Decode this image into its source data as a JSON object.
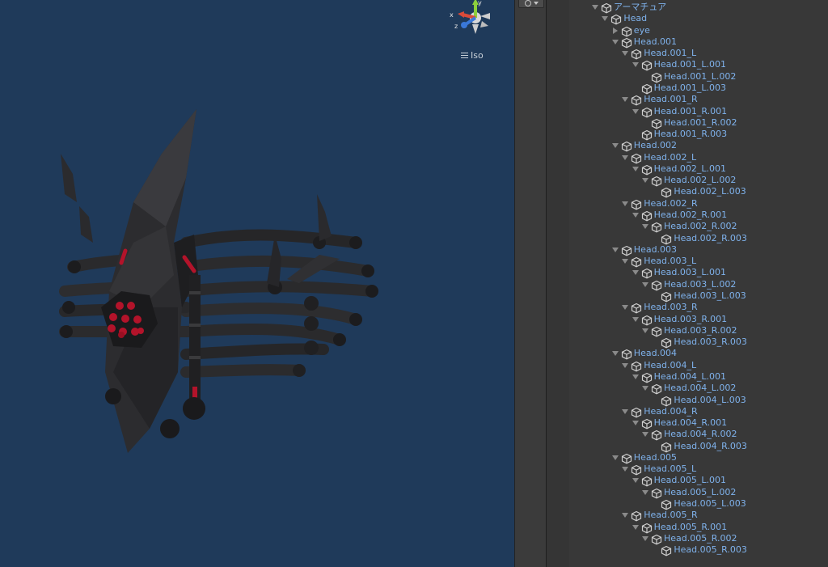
{
  "scene": {
    "view_mode_label": "Iso",
    "gizmo_axes": {
      "x": "x",
      "y": "y",
      "z": "z"
    },
    "colors": {
      "background": "#1f3a5a",
      "x_axis": "#d84a3a",
      "y_axis": "#8ccf3c",
      "z_axis": "#3a78d8",
      "accent_red": "#c0182a"
    },
    "icons": {
      "view_menu": "hamburger-icon"
    }
  },
  "toolbar": {
    "icons": [
      "gizmo-toggle-icon",
      "dropdown-arrow-icon"
    ]
  },
  "hierarchy": {
    "label_color": "#7fb2ec",
    "items": [
      {
        "label": "アーマチュア",
        "depth": 0,
        "expand": "down"
      },
      {
        "label": "Head",
        "depth": 1,
        "expand": "down"
      },
      {
        "label": "eye",
        "depth": 2,
        "expand": "right"
      },
      {
        "label": "Head.001",
        "depth": 2,
        "expand": "down"
      },
      {
        "label": "Head.001_L",
        "depth": 3,
        "expand": "down"
      },
      {
        "label": "Head.001_L.001",
        "depth": 4,
        "expand": "down"
      },
      {
        "label": "Head.001_L.002",
        "depth": 5,
        "expand": "none"
      },
      {
        "label": "Head.001_L.003",
        "depth": 4,
        "expand": "none"
      },
      {
        "label": "Head.001_R",
        "depth": 3,
        "expand": "down"
      },
      {
        "label": "Head.001_R.001",
        "depth": 4,
        "expand": "down"
      },
      {
        "label": "Head.001_R.002",
        "depth": 5,
        "expand": "none"
      },
      {
        "label": "Head.001_R.003",
        "depth": 4,
        "expand": "none"
      },
      {
        "label": "Head.002",
        "depth": 2,
        "expand": "down"
      },
      {
        "label": "Head.002_L",
        "depth": 3,
        "expand": "down"
      },
      {
        "label": "Head.002_L.001",
        "depth": 4,
        "expand": "down"
      },
      {
        "label": "Head.002_L.002",
        "depth": 5,
        "expand": "down"
      },
      {
        "label": "Head.002_L.003",
        "depth": 6,
        "expand": "none"
      },
      {
        "label": "Head.002_R",
        "depth": 3,
        "expand": "down"
      },
      {
        "label": "Head.002_R.001",
        "depth": 4,
        "expand": "down"
      },
      {
        "label": "Head.002_R.002",
        "depth": 5,
        "expand": "down"
      },
      {
        "label": "Head.002_R.003",
        "depth": 6,
        "expand": "none"
      },
      {
        "label": "Head.003",
        "depth": 2,
        "expand": "down"
      },
      {
        "label": "Head.003_L",
        "depth": 3,
        "expand": "down"
      },
      {
        "label": "Head.003_L.001",
        "depth": 4,
        "expand": "down"
      },
      {
        "label": "Head.003_L.002",
        "depth": 5,
        "expand": "down"
      },
      {
        "label": "Head.003_L.003",
        "depth": 6,
        "expand": "none"
      },
      {
        "label": "Head.003_R",
        "depth": 3,
        "expand": "down"
      },
      {
        "label": "Head.003_R.001",
        "depth": 4,
        "expand": "down"
      },
      {
        "label": "Head.003_R.002",
        "depth": 5,
        "expand": "down"
      },
      {
        "label": "Head.003_R.003",
        "depth": 6,
        "expand": "none"
      },
      {
        "label": "Head.004",
        "depth": 2,
        "expand": "down"
      },
      {
        "label": "Head.004_L",
        "depth": 3,
        "expand": "down"
      },
      {
        "label": "Head.004_L.001",
        "depth": 4,
        "expand": "down"
      },
      {
        "label": "Head.004_L.002",
        "depth": 5,
        "expand": "down"
      },
      {
        "label": "Head.004_L.003",
        "depth": 6,
        "expand": "none"
      },
      {
        "label": "Head.004_R",
        "depth": 3,
        "expand": "down"
      },
      {
        "label": "Head.004_R.001",
        "depth": 4,
        "expand": "down"
      },
      {
        "label": "Head.004_R.002",
        "depth": 5,
        "expand": "down"
      },
      {
        "label": "Head.004_R.003",
        "depth": 6,
        "expand": "none"
      },
      {
        "label": "Head.005",
        "depth": 2,
        "expand": "down"
      },
      {
        "label": "Head.005_L",
        "depth": 3,
        "expand": "down"
      },
      {
        "label": "Head.005_L.001",
        "depth": 4,
        "expand": "down"
      },
      {
        "label": "Head.005_L.002",
        "depth": 5,
        "expand": "down"
      },
      {
        "label": "Head.005_L.003",
        "depth": 6,
        "expand": "none"
      },
      {
        "label": "Head.005_R",
        "depth": 3,
        "expand": "down"
      },
      {
        "label": "Head.005_R.001",
        "depth": 4,
        "expand": "down"
      },
      {
        "label": "Head.005_R.002",
        "depth": 5,
        "expand": "down"
      },
      {
        "label": "Head.005_R.003",
        "depth": 6,
        "expand": "none"
      }
    ]
  }
}
